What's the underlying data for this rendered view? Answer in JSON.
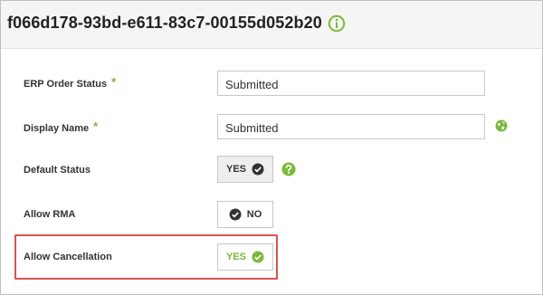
{
  "header": {
    "title": "f066d178-93bd-e611-83c7-00155d052b20"
  },
  "fields": {
    "erp_order_status": {
      "label": "ERP Order Status",
      "required_mark": "*",
      "value": "Submitted"
    },
    "display_name": {
      "label": "Display Name",
      "required_mark": "*",
      "value": "Submitted"
    },
    "default_status": {
      "label": "Default Status",
      "toggle": "YES"
    },
    "allow_rma": {
      "label": "Allow RMA",
      "toggle": "NO"
    },
    "allow_cancellation": {
      "label": "Allow Cancellation",
      "toggle": "YES"
    }
  },
  "colors": {
    "accent_green": "#7cb83a",
    "highlight_red": "#d9534f"
  },
  "icons": {
    "header": "info-icon",
    "display_name": "globe-icon",
    "default_status": "help-icon",
    "check": "check-circle-icon"
  }
}
